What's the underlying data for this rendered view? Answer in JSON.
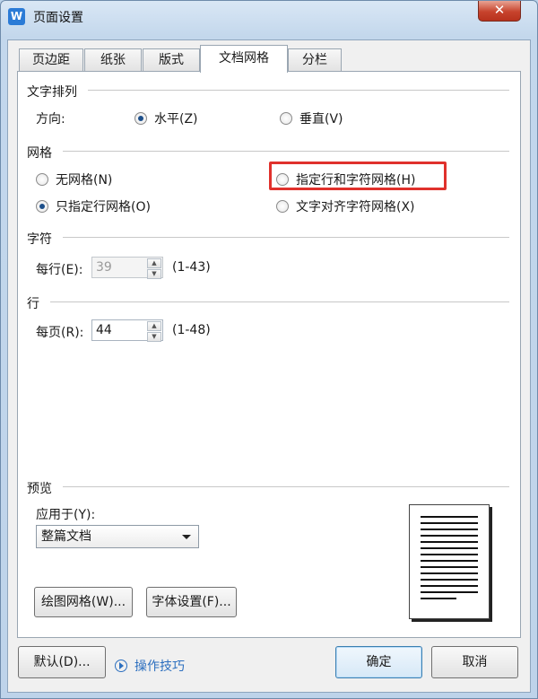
{
  "window": {
    "title": "页面设置",
    "app_icon_letter": "W",
    "close_glyph": "✕"
  },
  "tabs": [
    {
      "label": "页边距"
    },
    {
      "label": "纸张"
    },
    {
      "label": "版式"
    },
    {
      "label": "文档网格"
    },
    {
      "label": "分栏"
    }
  ],
  "active_tab": "文档网格",
  "text_direction": {
    "section": "文字排列",
    "direction_label": "方向:",
    "horizontal": "水平(Z)",
    "vertical": "垂直(V)",
    "selected": "horizontal"
  },
  "grid": {
    "section": "网格",
    "no_grid": "无网格(N)",
    "line_and_char": "指定行和字符网格(H)",
    "line_only": "只指定行网格(O)",
    "align_chars": "文字对齐字符网格(X)",
    "selected": "line_only"
  },
  "chars": {
    "section": "字符",
    "per_line_label": "每行(E):",
    "per_line_value": "39",
    "range": "(1-43)",
    "enabled": false
  },
  "lines": {
    "section": "行",
    "per_page_label": "每页(R):",
    "per_page_value": "44",
    "range": "(1-48)"
  },
  "preview": {
    "section": "预览",
    "apply_label": "应用于(Y):",
    "apply_value": "整篇文档"
  },
  "buttons": {
    "drawing_grid": "绘图网格(W)...",
    "font_settings": "字体设置(F)...",
    "default": "默认(D)...",
    "tips": "操作技巧",
    "ok": "确定",
    "cancel": "取消"
  },
  "colors": {
    "highlight": "#e0312c",
    "link": "#2c6fbf",
    "accent": "#1d4f8a"
  }
}
